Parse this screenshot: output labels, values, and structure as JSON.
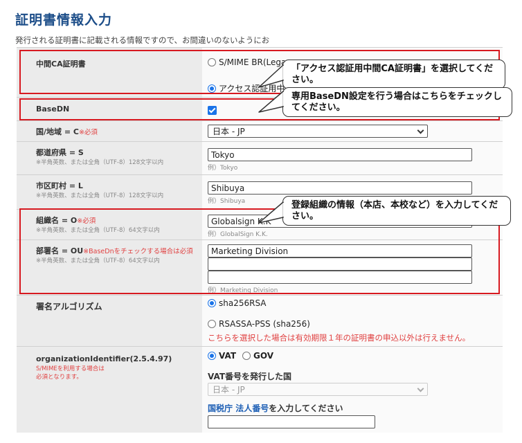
{
  "page": {
    "title": "証明書情報入力",
    "intro": "発行される証明書に記載される情報ですので、お間違いのないようにお"
  },
  "rows": {
    "ca": {
      "label": "中間CA証明書",
      "option1": "S/MIME BR(Lega",
      "option2": "アクセス認証用中"
    },
    "basedn": {
      "label": "BaseDN",
      "checked": true
    },
    "country": {
      "label": "国/地域 = C",
      "required": "※必須",
      "selected": "日本 - JP"
    },
    "state": {
      "label": "都道府県 = S",
      "note": "※半角英数、または全角（UTF-8）128文字以内",
      "value": "Tokyo",
      "example": "例）Tokyo"
    },
    "locality": {
      "label": "市区町村 = L",
      "note": "※半角英数、または全角（UTF-8）128文字以内",
      "value": "Shibuya",
      "example": "例）Shibuya"
    },
    "org": {
      "label": "組織名 = O",
      "required": "※必須",
      "note": "※半角英数、または全角（UTF-8）64文字以内",
      "value": "Globalsign K.K",
      "example": "例）GlobalSign K.K."
    },
    "ou": {
      "label": "部署名 = OU",
      "required": "※BaseDnをチェックする場合は必須",
      "note": "※半角英数、または全角（UTF-8）64文字以内",
      "value1": "Marketing Division",
      "value2": "",
      "value3": "",
      "example": "例）Marketing Division"
    },
    "sig": {
      "label": "署名アルゴリズム",
      "option1": "sha256RSA",
      "option2": "RSASSA-PSS (sha256)",
      "warning": "こちらを選択した場合は有効期限１年の証明書の申込以外は行えません。"
    },
    "oid": {
      "label": "organizationIdentifier(2.5.4.97)",
      "note1": "S/MIMEを利用する場合は",
      "note2": "必須となります。",
      "option_vat": "VAT",
      "option_gov": "GOV",
      "vat_country_label": "VAT番号を発行した国",
      "vat_country_selected": "日本 - JP",
      "tax_link": "国税庁",
      "corp_link": "法人番号",
      "tax_suffix": "を入力してください",
      "corp_number": ""
    }
  },
  "callouts": {
    "ca": "「アクセス認証用中間CA証明書」を選択してください。",
    "basedn": "専用BaseDN設定を行う場合はこちらをチェックしてください。",
    "org": "登録組織の情報（本店、本校など）を入力してください。"
  },
  "colors": {
    "title": "#1d4e89",
    "highlight": "#d71920",
    "required": "#e04040",
    "link": "#1d5fb5"
  }
}
